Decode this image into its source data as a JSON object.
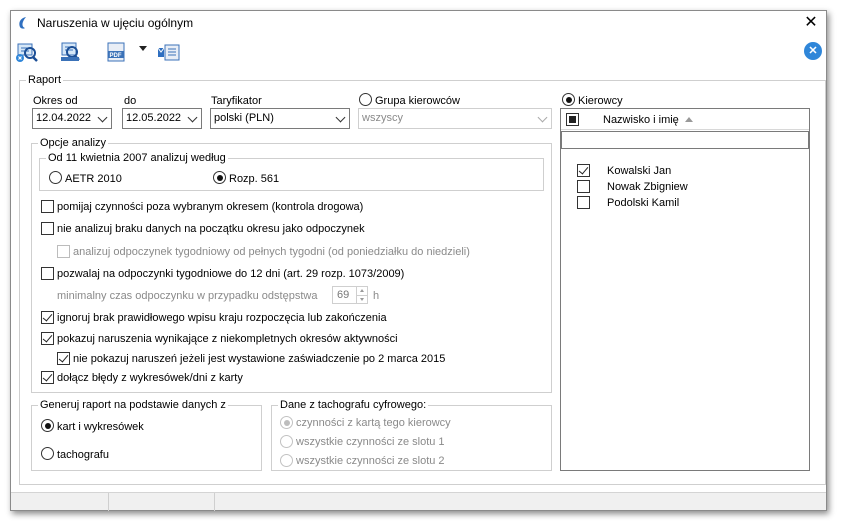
{
  "window": {
    "title": "Naruszenia w ujęciu ogólnym",
    "close_glyph": "✕"
  },
  "toolbar": {
    "icons": [
      "search-delete-icon",
      "search-print-icon",
      "pdf-export-icon",
      "email-send-icon"
    ],
    "close_glyph": "✕"
  },
  "raport": {
    "label": "Raport",
    "okres_od_label": "Okres od",
    "okres_od_value": "12.04.2022",
    "do_label": "do",
    "do_value": "12.05.2022",
    "taryfikator_label": "Taryfikator",
    "taryfikator_value": "polski (PLN)",
    "grupa_label": "Grupa kierowców",
    "grupa_value": "wszyscy",
    "kierowcy_label": "Kierowcy"
  },
  "opcje": {
    "label": "Opcje analizy",
    "subgroup_label": "Od 11 kwietnia 2007 analizuj według",
    "aetr_label": "AETR 2010",
    "rozp_label": "Rozp. 561",
    "options": [
      {
        "label": "pomijaj czynności poza wybranym okresem (kontrola drogowa)",
        "checked": false
      },
      {
        "label": "nie analizuj braku danych na początku okresu jako odpoczynek",
        "checked": false
      },
      {
        "label": "analizuj odpoczynek tygodniowy od pełnych tygodni (od poniedziałku do niedzieli)",
        "checked": false,
        "disabled": true
      },
      {
        "label": "pozwalaj na odpoczynki tygodniowe do 12 dni (art. 29 rozp. 1073/2009)",
        "checked": false
      },
      {
        "label": "ignoruj brak prawidłowego wpisu kraju rozpoczęcia lub zakończenia",
        "checked": true
      },
      {
        "label": "pokazuj naruszenia wynikające z niekompletnych okresów aktywności",
        "checked": true
      },
      {
        "label": "nie pokazuj naruszeń jeżeli jest wystawione zaświadczenie po 2 marca 2015",
        "checked": true
      },
      {
        "label": "dołącz błędy z wykresówek/dni z karty",
        "checked": true
      }
    ],
    "min_rest_label": "minimalny czas odpoczynku w przypadku odstępstwa",
    "min_rest_value": "69",
    "min_rest_unit": "h"
  },
  "generuj": {
    "label": "Generuj raport na podstawie danych z",
    "opt1": "kart i wykresówek",
    "opt2": "tachografu"
  },
  "dane": {
    "label": "Dane z tachografu cyfrowego:",
    "opt1": "czynności z kartą tego kierowcy",
    "opt2": "wszystkie czynności ze slotu 1",
    "opt3": "wszystkie czynności ze slotu 2"
  },
  "drivers": {
    "column": "Nazwisko i imię",
    "rows": [
      {
        "name": "Kowalski Jan",
        "checked": true
      },
      {
        "name": "Nowak Zbigniew",
        "checked": false
      },
      {
        "name": "Podolski Kamil",
        "checked": false
      }
    ]
  },
  "colors": {
    "accent": "#2f86d9"
  }
}
